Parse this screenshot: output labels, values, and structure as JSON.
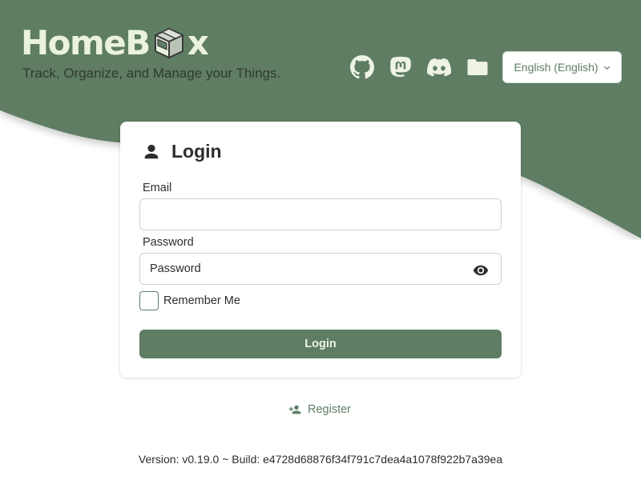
{
  "colors": {
    "primary": "#5e7d64",
    "primary_content": "#eef3e6",
    "logo_text": "#eaf2df",
    "text": "#2d2d2d"
  },
  "brand": {
    "name_prefix": "HomeB",
    "name_suffix": "x",
    "logo_icon": "box-icon",
    "tagline": "Track, Organize, and Manage your Things."
  },
  "nav": {
    "icons": [
      "github-icon",
      "mastodon-icon",
      "discord-icon",
      "folder-icon"
    ]
  },
  "language": {
    "selected": "English (English)"
  },
  "login_form": {
    "title": "Login",
    "title_icon": "user-icon",
    "email_label": "Email",
    "email_value": "",
    "password_label": "Password",
    "password_placeholder": "Password",
    "password_toggle_icon": "eye-icon",
    "remember_label": "Remember Me",
    "remember_checked": false,
    "submit_label": "Login"
  },
  "register": {
    "label": "Register",
    "icon": "user-plus-icon"
  },
  "footer": {
    "version_text": "Version: v0.19.0 ~ Build: e4728d68876f34f791c7dea4a1078f922b7a39ea"
  }
}
